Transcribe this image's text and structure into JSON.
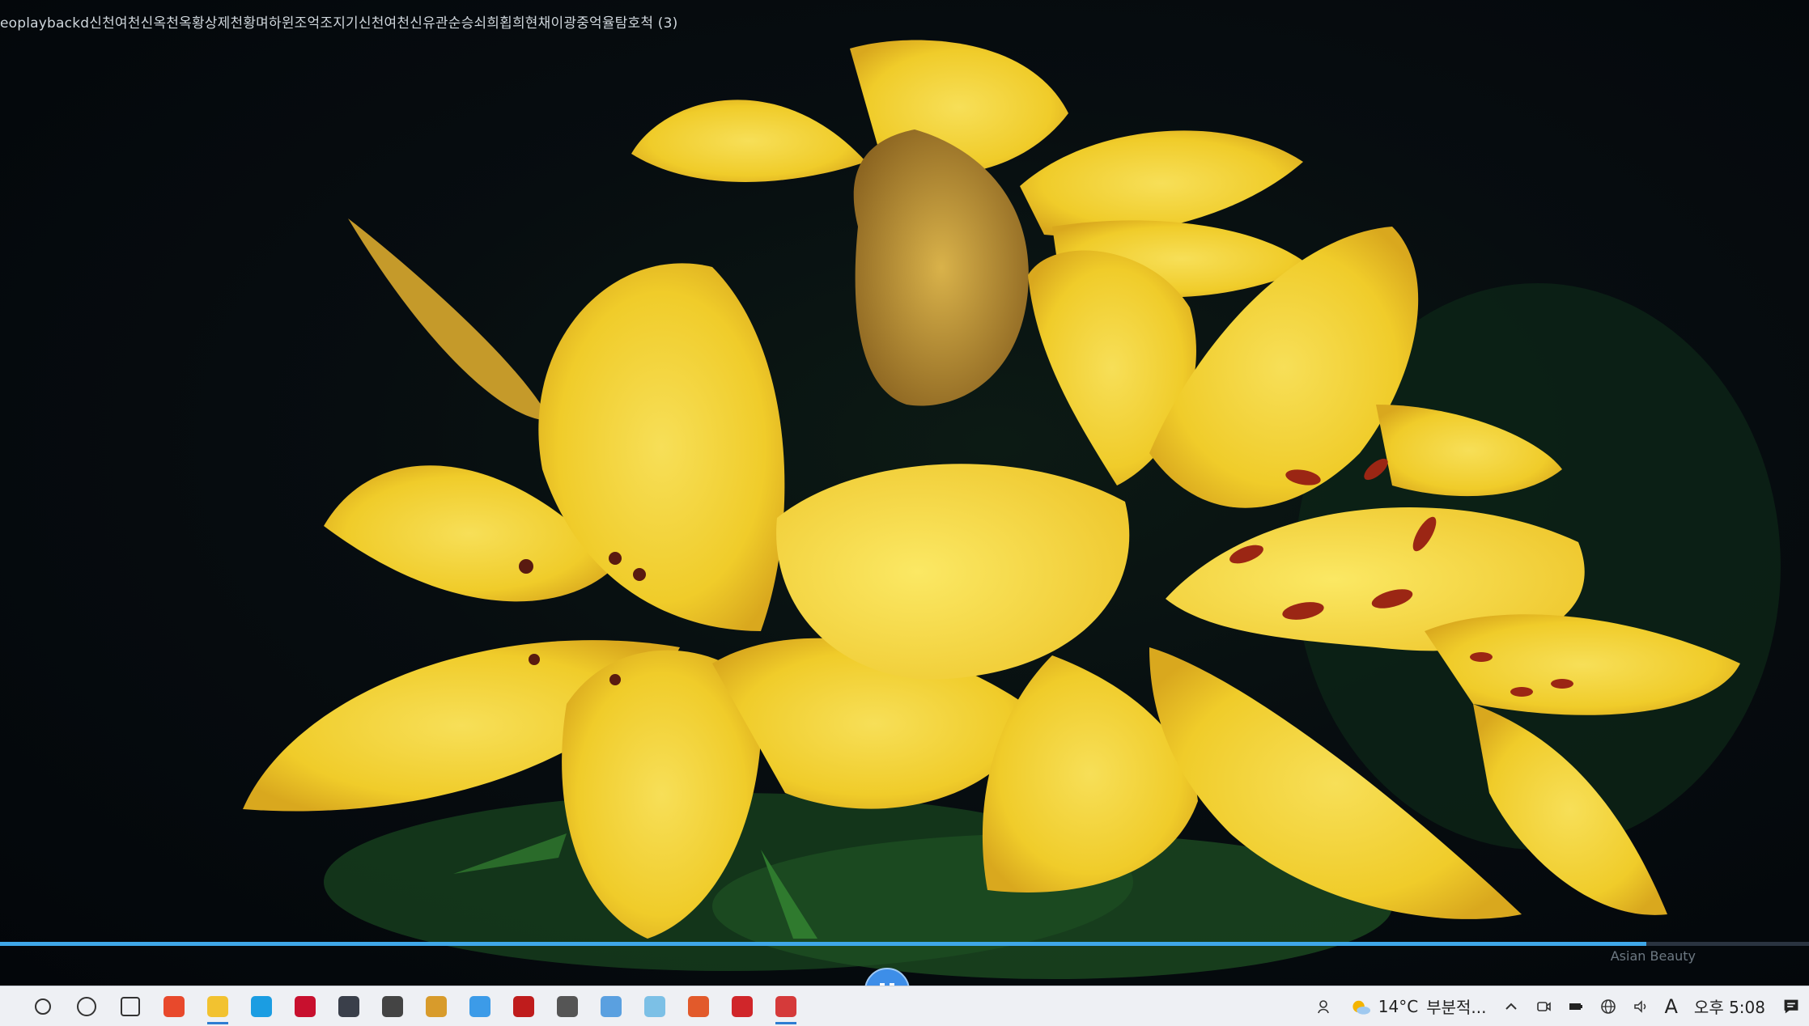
{
  "video": {
    "title": "eoplaybackd신천여천신옥천옥황상제천황며하윈조억조지기신천여천신유관순승쇠희횝희현채이광중억율탐호척 (3)",
    "watermark": "Asian Beauty",
    "progress": 0.91
  },
  "taskbar": {
    "apps": [
      {
        "name": "search-icon",
        "color": "#333333"
      },
      {
        "name": "cortana-icon",
        "color": "#333333"
      },
      {
        "name": "task-view-icon",
        "color": "#333333"
      },
      {
        "name": "office-icon",
        "color": "#e8492c"
      },
      {
        "name": "file-explorer-icon",
        "color": "#f2c230"
      },
      {
        "name": "edge-icon",
        "color": "#1b9de2"
      },
      {
        "name": "mcafee-icon",
        "color": "#c8102e"
      },
      {
        "name": "mail-icon",
        "color": "#3a3f4a"
      },
      {
        "name": "headset-icon",
        "color": "#444444"
      },
      {
        "name": "puzzle-icon",
        "color": "#d89b2b"
      },
      {
        "name": "chrome-like-icon",
        "color": "#3c9be8"
      },
      {
        "name": "filezilla-icon",
        "color": "#bf1c1c"
      },
      {
        "name": "settings-icon",
        "color": "#555555"
      },
      {
        "name": "notepad-icon",
        "color": "#5aa0e0"
      },
      {
        "name": "pen-icon",
        "color": "#7cc0e6"
      },
      {
        "name": "media-player-icon",
        "color": "#e25a2b"
      },
      {
        "name": "pdf-icon",
        "color": "#d0262a"
      },
      {
        "name": "video-app-icon",
        "color": "#d53a3a"
      }
    ],
    "tray": {
      "weather_temp": "14°C",
      "weather_desc": "부분적...",
      "ime_label": "A",
      "clock": "오후 5:08"
    }
  }
}
